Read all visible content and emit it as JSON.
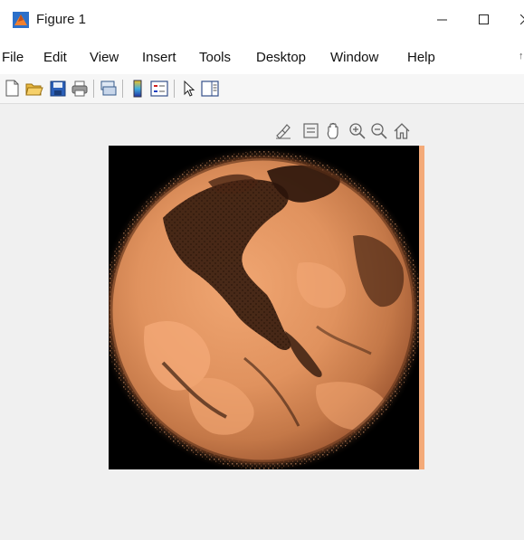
{
  "window": {
    "title": "Figure 1",
    "controls": [
      "minimize",
      "maximize",
      "close"
    ]
  },
  "menu": {
    "items": [
      "File",
      "Edit",
      "View",
      "Insert",
      "Tools",
      "Desktop",
      "Window",
      "Help"
    ]
  },
  "toolbar": {
    "buttons": [
      "new-figure-icon",
      "open-file-icon",
      "save-icon",
      "print-icon",
      "link-plot-icon",
      "insert-colorbar-icon",
      "insert-legend-icon",
      "edit-plot-icon",
      "property-inspector-icon"
    ]
  },
  "axes_toolbar": {
    "buttons": [
      "brush-icon",
      "data-tips-icon",
      "pan-icon",
      "zoom-in-icon",
      "zoom-out-icon",
      "restore-view-icon"
    ]
  },
  "image": {
    "subject": "earth-globe",
    "colormap": "copper",
    "colors": {
      "dark": "#1a0c06",
      "mid": "#7a4a30",
      "light": "#e89a66",
      "bright": "#f4aa78"
    }
  }
}
